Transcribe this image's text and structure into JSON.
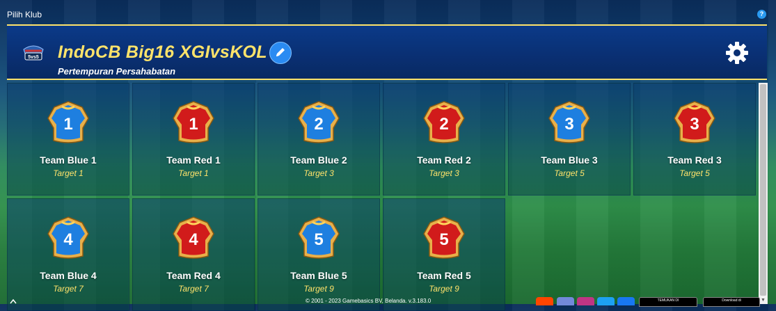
{
  "topbar": {
    "title": "Pilih Klub",
    "help_icon": "?"
  },
  "header": {
    "club_name": "IndoCB Big16 XGIvsKOL",
    "subtitle": "Pertempuran Persahabatan",
    "logo_text": "5vs5",
    "edit_icon": "pencil-icon",
    "settings_icon": "gear-icon"
  },
  "teams": [
    {
      "name": "Team Blue 1",
      "target": "Target 1",
      "number": "1",
      "color": "blue"
    },
    {
      "name": "Team Red 1",
      "target": "Target 1",
      "number": "1",
      "color": "red"
    },
    {
      "name": "Team Blue 2",
      "target": "Target 3",
      "number": "2",
      "color": "blue"
    },
    {
      "name": "Team Red 2",
      "target": "Target 3",
      "number": "2",
      "color": "red"
    },
    {
      "name": "Team Blue 3",
      "target": "Target 5",
      "number": "3",
      "color": "blue"
    },
    {
      "name": "Team Red 3",
      "target": "Target 5",
      "number": "3",
      "color": "red"
    },
    {
      "name": "Team Blue 4",
      "target": "Target 7",
      "number": "4",
      "color": "blue"
    },
    {
      "name": "Team Red 4",
      "target": "Target 7",
      "number": "4",
      "color": "red"
    },
    {
      "name": "Team Blue 5",
      "target": "Target 9",
      "number": "5",
      "color": "blue"
    },
    {
      "name": "Team Red 5",
      "target": "Target 9",
      "number": "5",
      "color": "red"
    }
  ],
  "footer": {
    "copyright": "© 2001 - 2023 Gamebasics BV, Belanda. v.3.183.0",
    "store_google": "TEMUKAN DI",
    "store_apple": "Download di"
  },
  "colors": {
    "accent_yellow": "#ffe36a",
    "blue_shirt": "#1e7fe0",
    "red_shirt": "#d11b1b",
    "badge_gold": "#e8b04a"
  }
}
